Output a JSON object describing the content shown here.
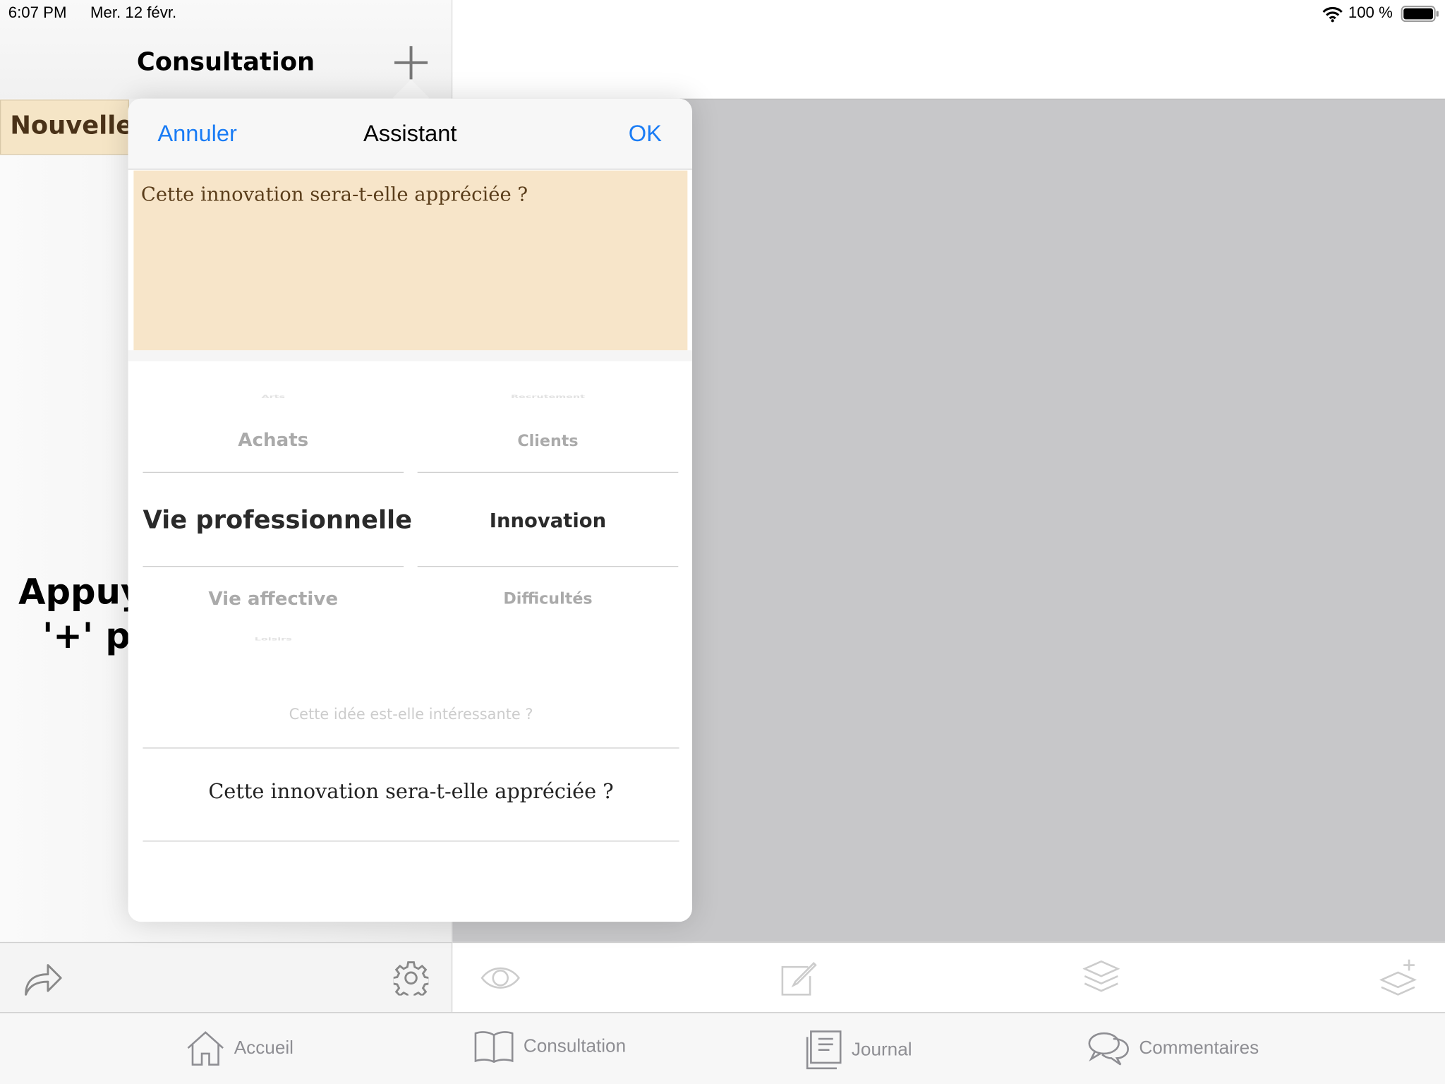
{
  "status_bar": {
    "time": "6:07 PM",
    "date": "Mer. 12 févr.",
    "battery": "100 %"
  },
  "left_panel": {
    "title": "Consultation",
    "tab": "Nouvelle",
    "hint_line1": "Appuyez sur",
    "hint_line2": "'+' po"
  },
  "popover": {
    "cancel": "Annuler",
    "title": "Assistant",
    "ok": "OK",
    "note_text": "Cette innovation sera-t-elle appréciée ?",
    "picker_categories": {
      "col1": [
        "Arts",
        "Achats",
        "Vie professionnelle",
        "Vie affective",
        "Loisirs"
      ],
      "col2": [
        "Recrutement",
        "Clients",
        "Innovation",
        "Difficultés"
      ],
      "selected_col1": "Vie professionnelle",
      "selected_col2": "Innovation"
    },
    "picker_questions": {
      "items": [
        "Cette idée est-elle intéressante ?",
        "Cette innovation sera-t-elle appréciée ?"
      ],
      "selected": "Cette innovation sera-t-elle appréciée ?"
    }
  },
  "tabs": [
    {
      "label": "Accueil",
      "icon": "house-icon"
    },
    {
      "label": "Consultation",
      "icon": "book-icon"
    },
    {
      "label": "Journal",
      "icon": "journal-icon"
    },
    {
      "label": "Commentaires",
      "icon": "chat-bubbles-icon"
    }
  ],
  "colors": {
    "accent": "#1a7cf5",
    "note_bg": "#f7e5c9",
    "tab_grey": "#8e8e93"
  }
}
